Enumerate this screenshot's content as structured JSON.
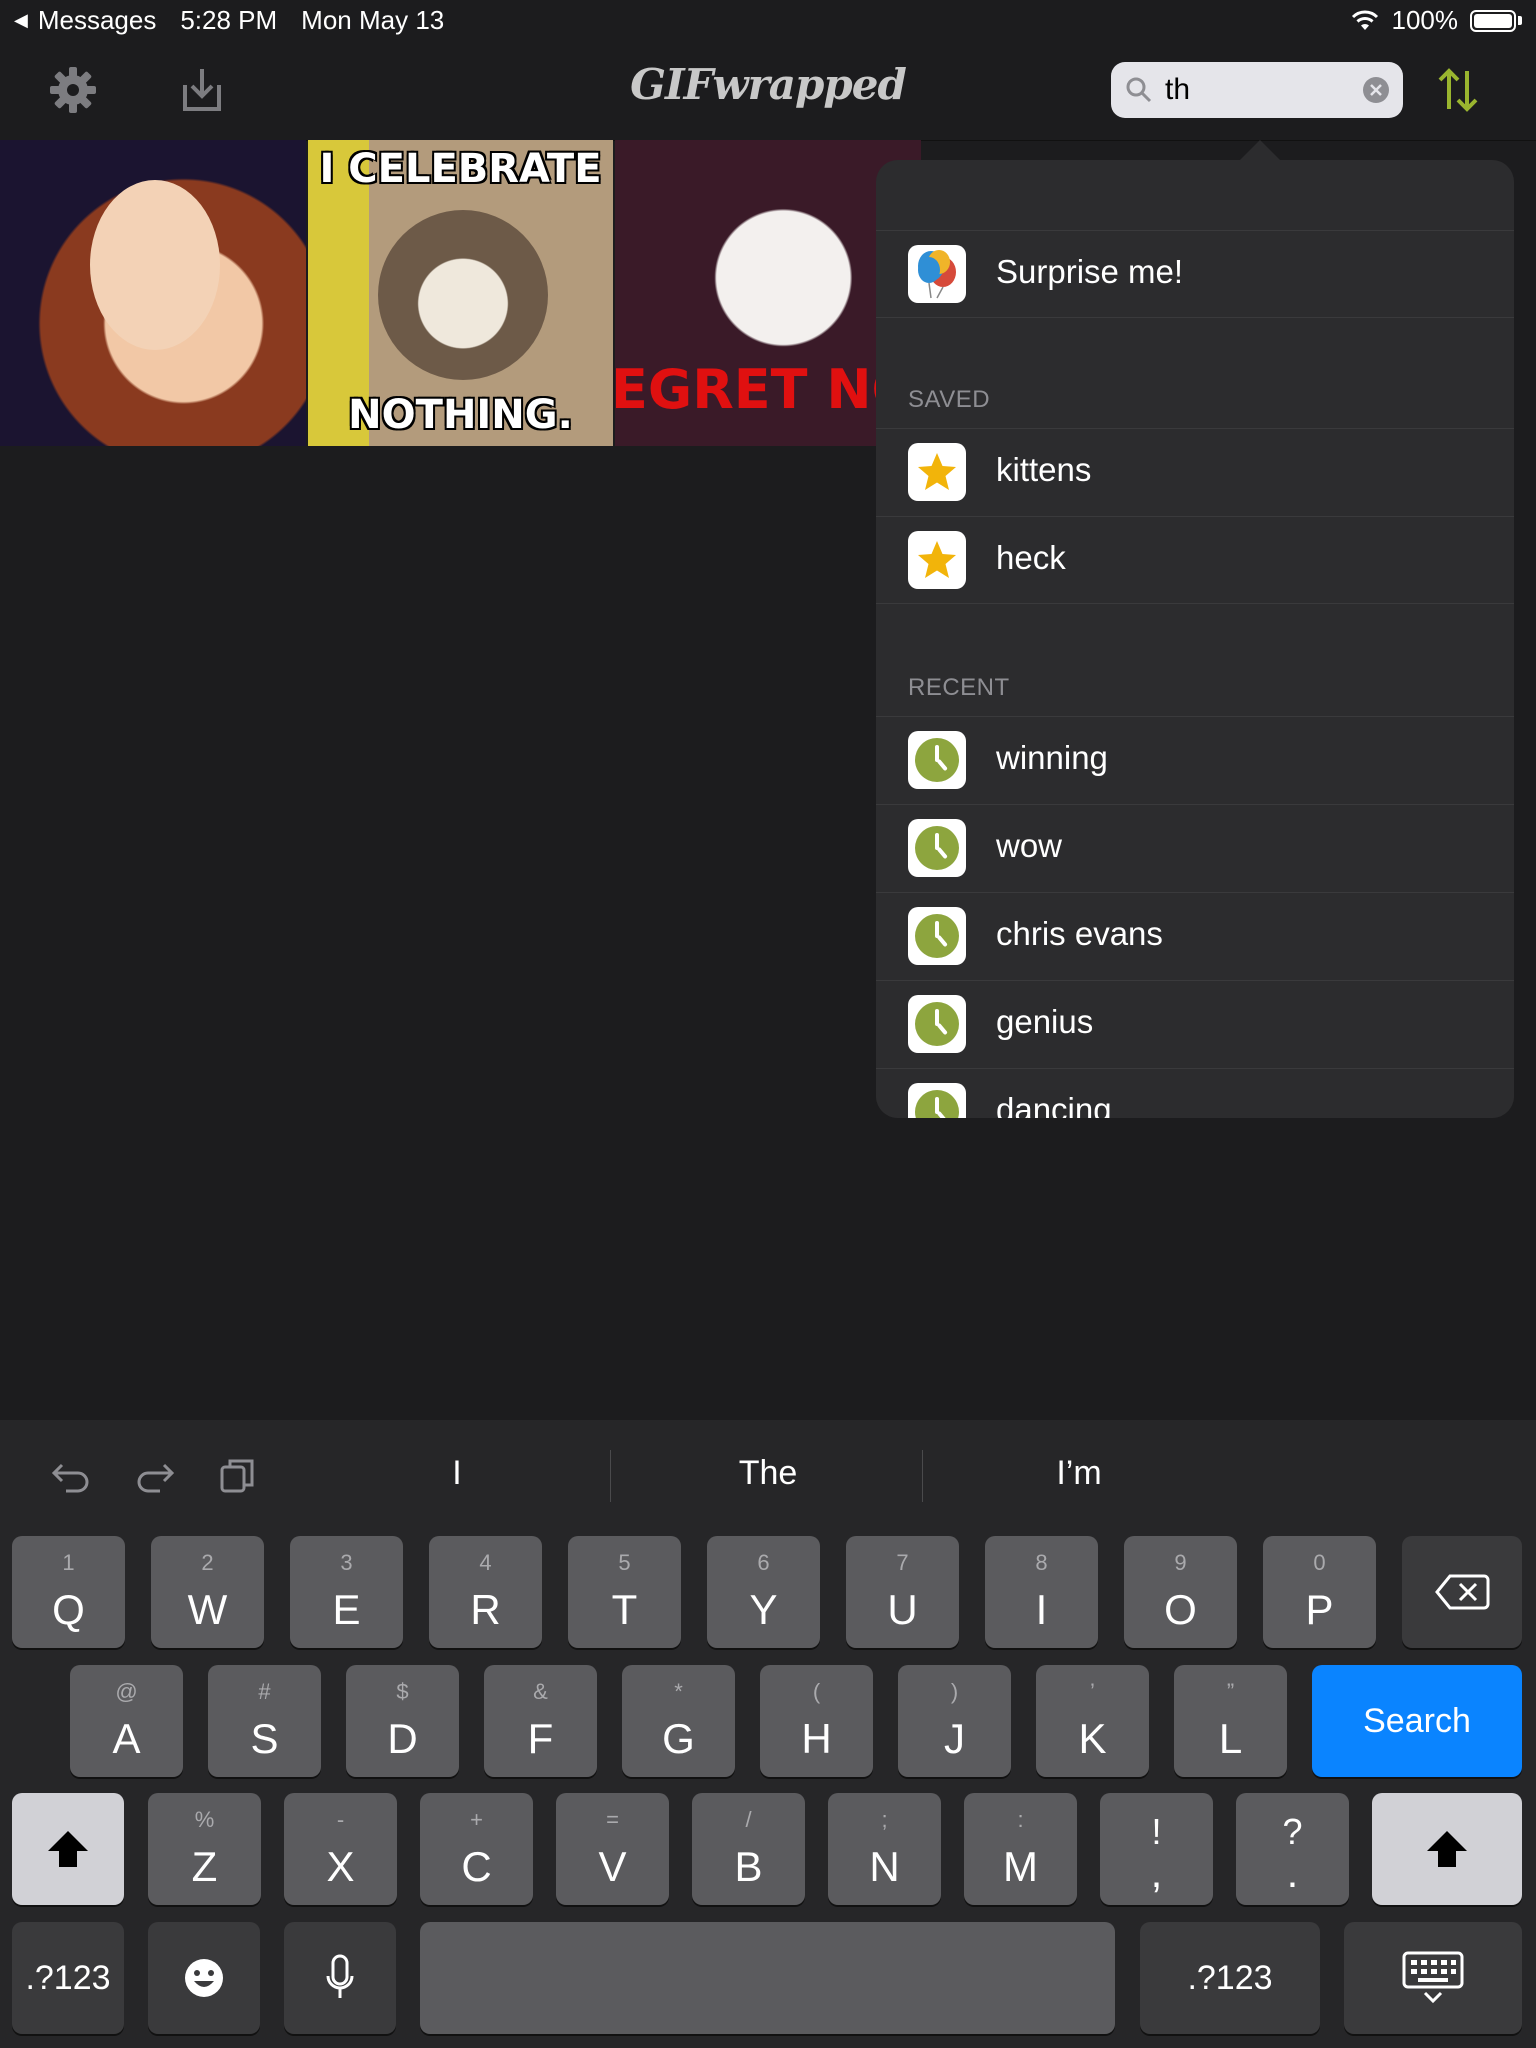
{
  "status_bar": {
    "back_app": "Messages",
    "time": "5:28 PM",
    "date": "Mon May 13",
    "battery": "100%"
  },
  "navbar": {
    "title": "GIFwrapped",
    "search_value": "th"
  },
  "gifs": [
    {
      "caption_top": "",
      "caption_bottom": ""
    },
    {
      "caption_top": "I CELEBRATE",
      "caption_bottom": "NOTHING."
    },
    {
      "caption_top": "",
      "caption_bottom": "EGRET NO"
    }
  ],
  "popover": {
    "surprise": "Surprise me!",
    "saved_header": "SAVED",
    "saved": [
      "kittens",
      "heck"
    ],
    "recent_header": "RECENT",
    "recent": [
      "winning",
      "wow",
      "chris evans",
      "genius",
      "dancing"
    ]
  },
  "keyboard": {
    "suggestions": [
      "I",
      "The",
      "I’m"
    ],
    "row1": [
      {
        "sub": "1",
        "main": "Q"
      },
      {
        "sub": "2",
        "main": "W"
      },
      {
        "sub": "3",
        "main": "E"
      },
      {
        "sub": "4",
        "main": "R"
      },
      {
        "sub": "5",
        "main": "T"
      },
      {
        "sub": "6",
        "main": "Y"
      },
      {
        "sub": "7",
        "main": "U"
      },
      {
        "sub": "8",
        "main": "I"
      },
      {
        "sub": "9",
        "main": "O"
      },
      {
        "sub": "0",
        "main": "P"
      }
    ],
    "row2": [
      {
        "sub": "@",
        "main": "A"
      },
      {
        "sub": "#",
        "main": "S"
      },
      {
        "sub": "$",
        "main": "D"
      },
      {
        "sub": "&",
        "main": "F"
      },
      {
        "sub": "*",
        "main": "G"
      },
      {
        "sub": "(",
        "main": "H"
      },
      {
        "sub": ")",
        "main": "J"
      },
      {
        "sub": "’",
        "main": "K"
      },
      {
        "sub": "”",
        "main": "L"
      }
    ],
    "row3": [
      {
        "sub": "%",
        "main": "Z"
      },
      {
        "sub": "-",
        "main": "X"
      },
      {
        "sub": "+",
        "main": "C"
      },
      {
        "sub": "=",
        "main": "V"
      },
      {
        "sub": "/",
        "main": "B"
      },
      {
        "sub": ";",
        "main": "N"
      },
      {
        "sub": ":",
        "main": "M"
      },
      {
        "sub": "!",
        "main": ","
      },
      {
        "sub": "?",
        "main": "."
      }
    ],
    "search_label": "Search",
    "numbers_label": ".?123"
  }
}
